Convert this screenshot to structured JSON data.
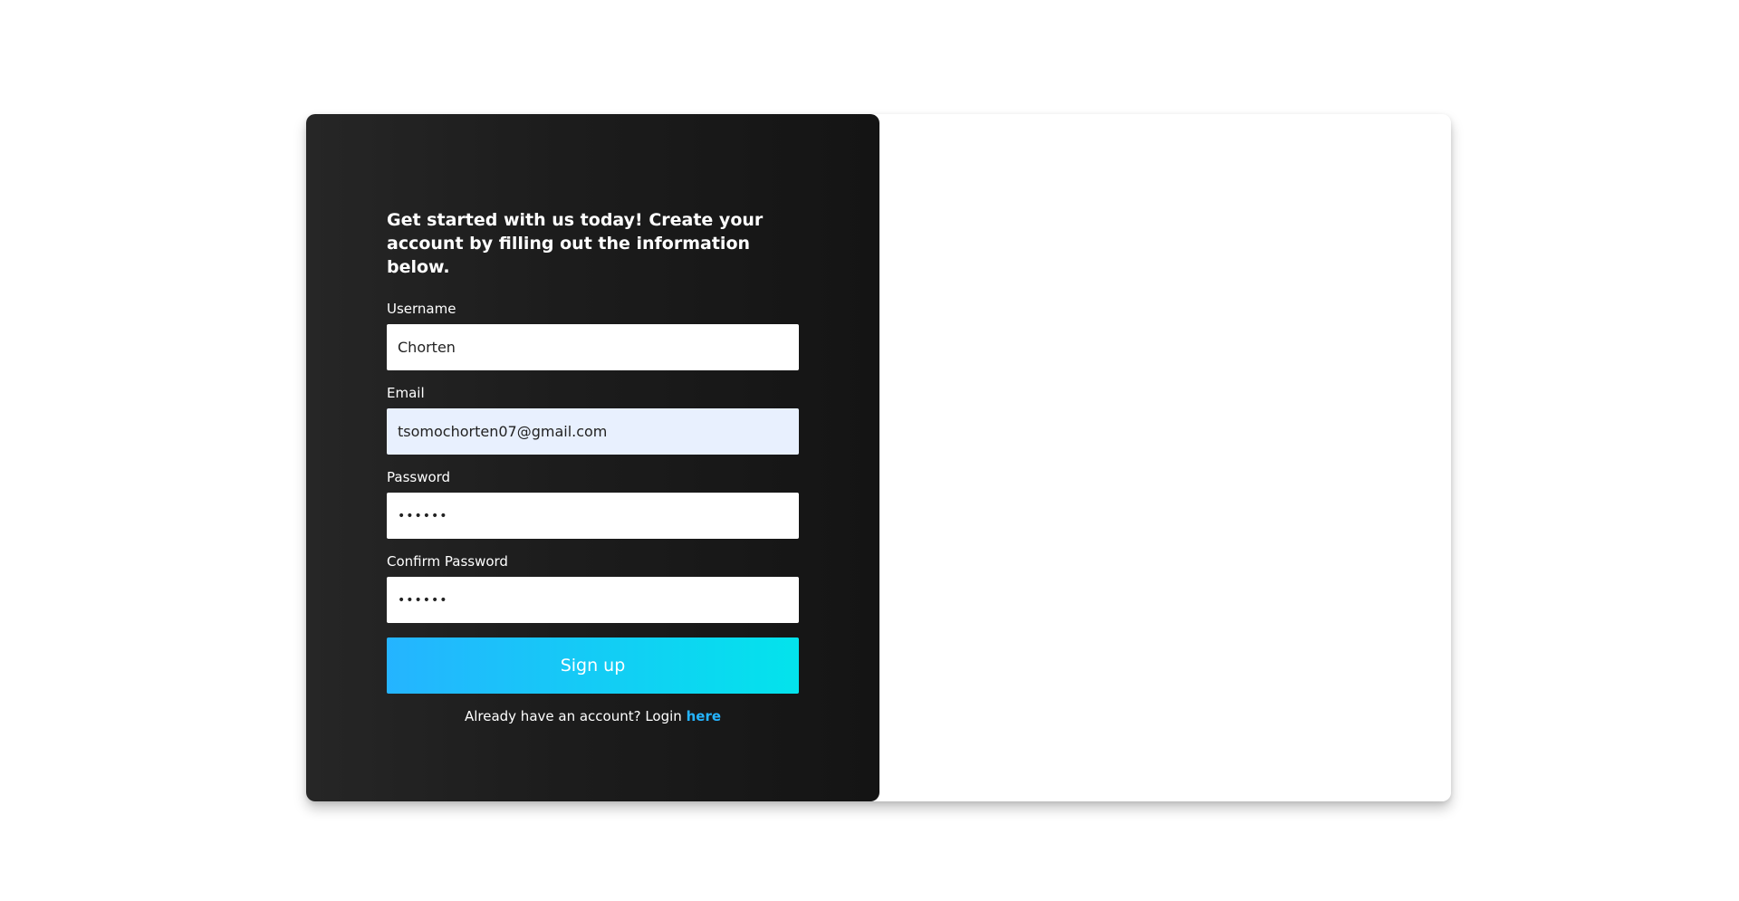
{
  "form": {
    "intro": "Get started with us today! Create your account by filling out the information below.",
    "username": {
      "label": "Username",
      "value": "Chorten"
    },
    "email": {
      "label": "Email",
      "value": "tsomochorten07@gmail.com"
    },
    "password": {
      "label": "Password",
      "value": "••••••"
    },
    "confirm_password": {
      "label": "Confirm Password",
      "value": "••••••"
    },
    "submit_label": "Sign up",
    "login_prompt": "Already have an account? Login",
    "login_link": "here"
  },
  "colors": {
    "panel_dark": "#1c1c1c",
    "button_gradient_start": "#25b4ff",
    "button_gradient_end": "#03e3ec",
    "link": "#25b4ff",
    "autofill_bg": "#e8f0fe"
  }
}
